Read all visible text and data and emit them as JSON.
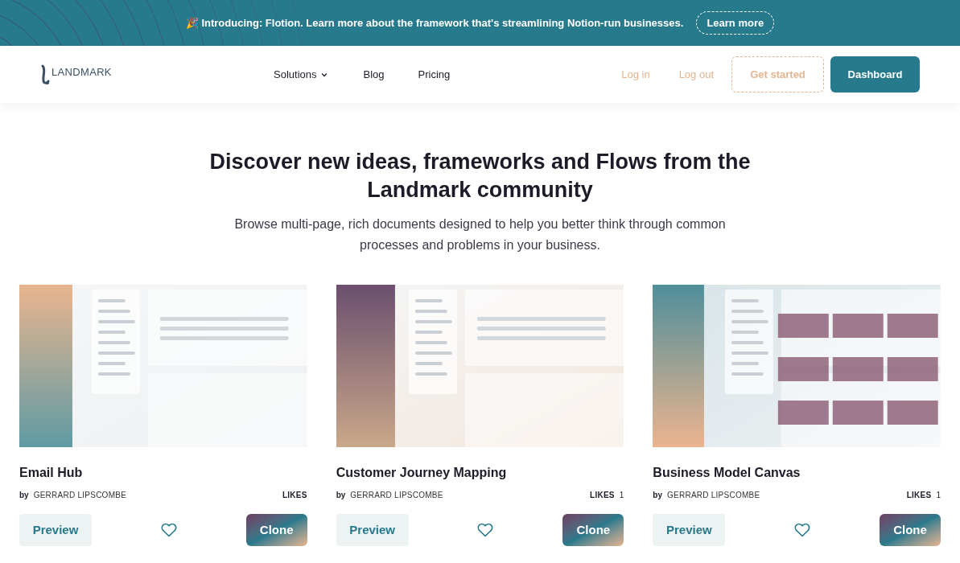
{
  "banner": {
    "emoji": "🎉",
    "text": "Introducing: Flotion. Learn more about the framework that's streamlining Notion-run businesses.",
    "button": "Learn more"
  },
  "nav": {
    "logo": "LANDMARK",
    "links": [
      {
        "label": "Solutions",
        "dropdown": true
      },
      {
        "label": "Blog",
        "dropdown": false
      },
      {
        "label": "Pricing",
        "dropdown": false
      }
    ],
    "login": "Log in",
    "logout": "Log out",
    "get_started": "Get started",
    "dashboard": "Dashboard"
  },
  "hero": {
    "title": "Discover new ideas, frameworks and Flows from the Landmark community",
    "subtitle": "Browse multi-page, rich documents designed to help you better think through common processes and problems in your business."
  },
  "cards": [
    {
      "title": "Email Hub",
      "by": "by",
      "author": "GERRARD LIPSCOMBE",
      "likes_label": "LIKES",
      "preview": "Preview",
      "clone": "Clone"
    },
    {
      "title": "Customer Journey Mapping",
      "by": "by",
      "author": "GERRARD LIPSCOMBE",
      "likes_label": "LIKES",
      "likes": "1",
      "preview": "Preview",
      "clone": "Clone"
    },
    {
      "title": "Business Model Canvas",
      "by": "by",
      "author": "GERRARD LIPSCOMBE",
      "likes_label": "LIKES",
      "likes": "1",
      "preview": "Preview",
      "clone": "Clone"
    }
  ]
}
